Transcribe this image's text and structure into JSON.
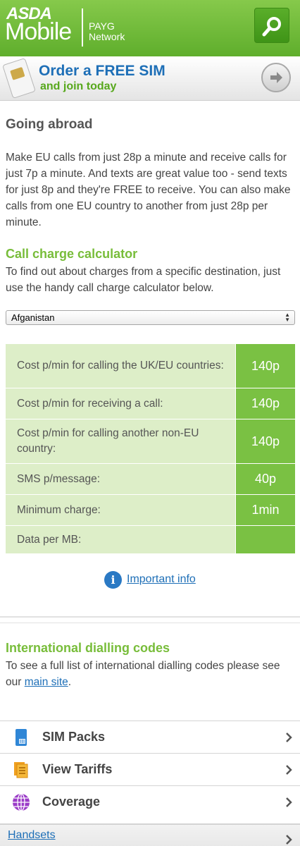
{
  "header": {
    "logo_top": "ASDA",
    "logo_main": "Mobile",
    "logo_payg": "PAYG",
    "logo_network": "Network",
    "search_icon": "search-icon",
    "brand_color": "#6cb83a"
  },
  "promo": {
    "title": "Order a FREE SIM",
    "subtitle": "and join today",
    "icon": "sim-card-icon",
    "arrow_icon": "arrow-right-circle-icon"
  },
  "page": {
    "heading": "Going abroad",
    "intro": "Make EU calls from just 28p a minute and receive calls for just 7p a minute. And texts are great value too - send texts for just 8p and they're FREE to receive. You can also make calls from one EU country to another from just 28p per minute."
  },
  "calculator": {
    "heading": "Call charge calculator",
    "text": "To find out about charges from a specific destination, just use the handy call charge calculator below.",
    "selected_country": "Afganistan",
    "rows": [
      {
        "label": "Cost p/min for calling the UK/EU countries:",
        "value": "140p"
      },
      {
        "label": "Cost p/min for receiving a call:",
        "value": "140p"
      },
      {
        "label": "Cost p/min for calling another non-EU country:",
        "value": "140p"
      },
      {
        "label": "SMS p/message:",
        "value": "40p"
      },
      {
        "label": "Minimum charge:",
        "value": "1min"
      },
      {
        "label": "Data per MB:",
        "value": ""
      }
    ],
    "info_link": "Important info",
    "info_icon": "info-icon"
  },
  "dialling": {
    "heading": "International dialling codes",
    "text_before": "To see a full list of international dialling codes please see our ",
    "link": "main site",
    "text_after": "."
  },
  "menu": [
    {
      "label": "SIM Packs",
      "icon": "sim-pack-icon"
    },
    {
      "label": "View Tariffs",
      "icon": "tariffs-icon"
    },
    {
      "label": "Coverage",
      "icon": "globe-icon"
    }
  ],
  "footer": {
    "handsets": "Handsets"
  }
}
